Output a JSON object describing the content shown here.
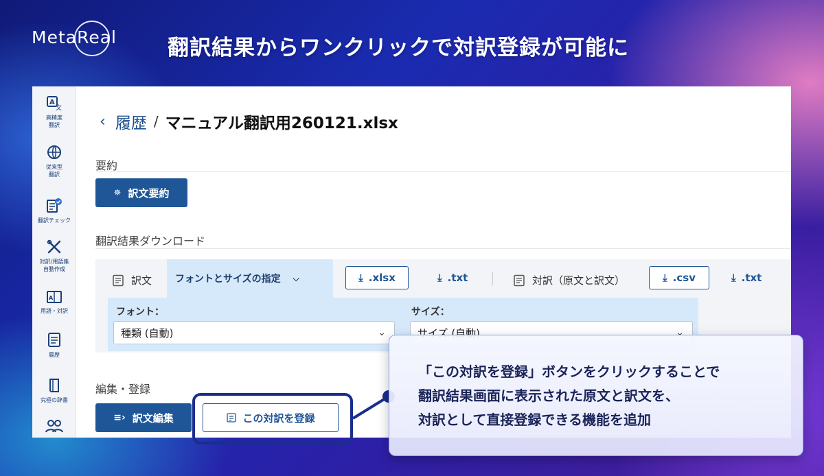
{
  "brand": {
    "logo_text": "MetaReal"
  },
  "headline": "翻訳結果からワンクリックで対訳登録が可能に",
  "sidebar": {
    "items": [
      {
        "label": "高精度\n翻訳",
        "icon": "translate-icon"
      },
      {
        "label": "従来型\n翻訳",
        "icon": "globe-translate-icon"
      },
      {
        "label": "翻訳チェック",
        "icon": "check-document-icon"
      },
      {
        "label": "対訳/用語集\n自動作成",
        "icon": "tools-icon"
      },
      {
        "label": "用語・対訳",
        "icon": "glossary-icon"
      },
      {
        "label": "履歴",
        "icon": "history-icon"
      },
      {
        "label": "究極の辞書",
        "icon": "dictionary-icon"
      },
      {
        "label": "",
        "icon": "users-icon"
      }
    ]
  },
  "breadcrumb": {
    "back_icon": "chevron-left-icon",
    "link": "履歴",
    "separator": "/",
    "file": "マニュアル翻訳用260121.xlsx"
  },
  "summary": {
    "section_label": "要約",
    "button_label": "訳文要約"
  },
  "download": {
    "section_label": "翻訳結果ダウンロード",
    "translation_label": "訳文",
    "font_tab_label": "フォントとサイズの指定",
    "xlsx_label": ".xlsx",
    "txt_label": ".txt",
    "parallel_label": "対訳（原文と訳文）",
    "csv_label": ".csv",
    "txt2_label": ".txt",
    "font_field_label": "フォント：",
    "font_value": "種類 (自動)",
    "size_field_label": "サイズ：",
    "size_value": "サイズ (自動)"
  },
  "edit": {
    "section_label": "編集・登録",
    "edit_button_label": "訳文編集",
    "register_button_label": "この対訳を登録"
  },
  "callout": {
    "line1": "「この対訳を登録」ボタンをクリックすることで",
    "line2": "翻訳結果画面に表示された原文と訳文を、",
    "line3": "対訳として直接登録できる機能を追加"
  },
  "colors": {
    "accent": "#1f5697",
    "panel_highlight": "#d6e9fb",
    "callout_text": "#1b2458"
  }
}
